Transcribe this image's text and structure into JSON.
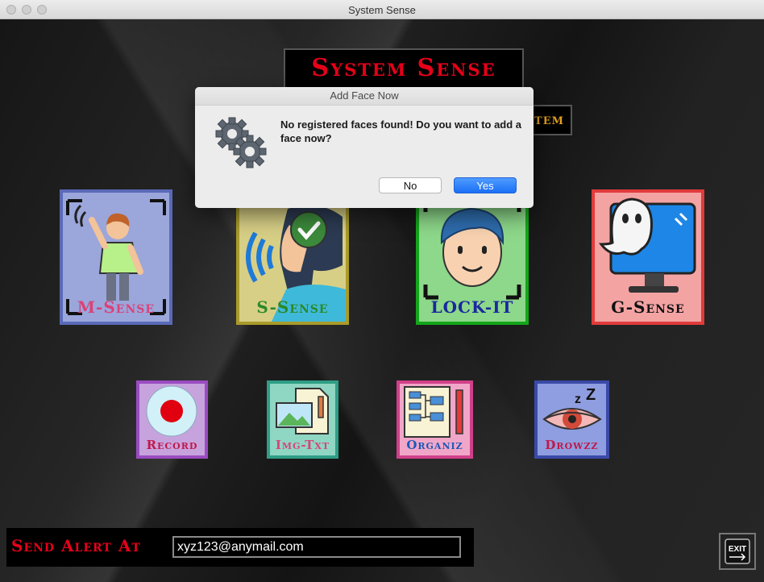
{
  "window": {
    "title": "System Sense"
  },
  "brand": {
    "title": "System Sense",
    "subtitle_visible": "tem"
  },
  "tiles": {
    "m_sense": {
      "label": "M-Sense",
      "bg": "#9ba6db",
      "border": "#5a6ab8",
      "text": "#d8437a"
    },
    "s_sense": {
      "label": "S-Sense",
      "bg": "#d8cf86",
      "border": "#a99b2a",
      "text": "#2a8a2a"
    },
    "lock_it": {
      "label": "LOCK-IT",
      "bg": "#8dd88a",
      "border": "#13a51a",
      "text": "#1a28a0"
    },
    "g_sense": {
      "label": "G-Sense",
      "bg": "#f4a3a3",
      "border": "#e03b3b",
      "text": "#111111"
    },
    "record": {
      "label": "Record",
      "bg": "#c7a3dd",
      "border": "#9a4cc0",
      "text": "#c0184a"
    },
    "img_txt": {
      "label": "Img-Txt",
      "bg": "#8fd6c3",
      "border": "#2f9e86",
      "text": "#d8437a"
    },
    "organiz": {
      "label": "Organiz",
      "bg": "#f0a6c8",
      "border": "#d0408a",
      "text": "#1c58b8"
    },
    "drowzz": {
      "label": "Drowzz",
      "bg": "#8f9ee0",
      "border": "#3a4aa8",
      "text": "#c0184a"
    }
  },
  "alert": {
    "label": "Send Alert At",
    "email": "xyz123@anymail.com"
  },
  "exit": {
    "label": "EXIT"
  },
  "dialog": {
    "title": "Add Face Now",
    "message": "No registered faces found! Do you want to add a face now?",
    "no_label": "No",
    "yes_label": "Yes"
  }
}
